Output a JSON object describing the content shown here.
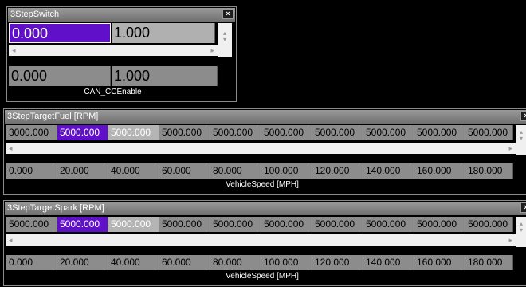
{
  "switch_panel": {
    "title": "3StepSwitch",
    "close_glyph": "×",
    "table_values": [
      "0.000",
      "1.000"
    ],
    "axis_values": [
      "0.000",
      "1.000"
    ],
    "axis_label": "CAN_CCEnable"
  },
  "fuel_panel": {
    "title": "3StepTargetFuel [RPM]",
    "close_glyph": "×",
    "table_values": [
      "3000.000",
      "5000.000",
      "5000.000",
      "5000.000",
      "5000.000",
      "5000.000",
      "5000.000",
      "5000.000",
      "5000.000",
      "5000.000"
    ],
    "axis_values": [
      "0.000",
      "20.000",
      "40.000",
      "60.000",
      "80.000",
      "100.000",
      "120.000",
      "140.000",
      "160.000",
      "180.000"
    ],
    "axis_label": "VehicleSpeed [MPH]"
  },
  "spark_panel": {
    "title": "3StepTargetSpark [RPM]",
    "close_glyph": "×",
    "table_values": [
      "5000.000",
      "5000.000",
      "5000.000",
      "5000.000",
      "5000.000",
      "5000.000",
      "5000.000",
      "5000.000",
      "5000.000",
      "5000.000"
    ],
    "axis_values": [
      "0.000",
      "20.000",
      "40.000",
      "60.000",
      "80.000",
      "100.000",
      "120.000",
      "140.000",
      "160.000",
      "180.000"
    ],
    "axis_label": "VehicleSpeed [MPH]"
  },
  "scroll_glyphs": {
    "left": "◂",
    "right": "▸",
    "up": "▴",
    "down": "▾"
  },
  "colors": {
    "selected": "#6010c8",
    "cell": "#8c8c8c",
    "cell_light": "#b4b4b4",
    "background": "#000000"
  }
}
